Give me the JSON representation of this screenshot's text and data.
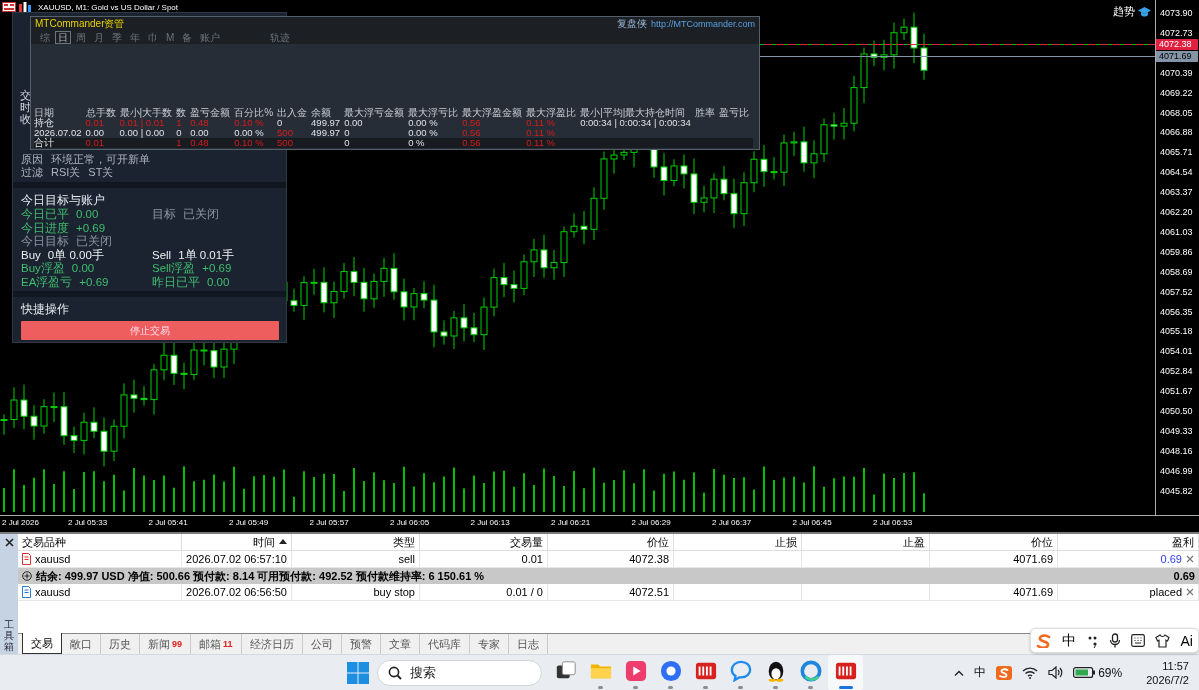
{
  "chart": {
    "title": "XAUUSD, M1:  Gold vs US Dollar / Spot",
    "indicator_label": "趋势",
    "price_ticks": [
      "4073.90",
      "4072.73",
      "4070.39",
      "4069.22",
      "4068.05",
      "4066.88",
      "4065.71",
      "4064.54",
      "4063.37",
      "4062.20",
      "4061.03",
      "4059.86",
      "4058.69",
      "4057.52",
      "4056.35",
      "4055.18",
      "4054.01",
      "4052.84",
      "4051.67",
      "4050.50",
      "4049.33",
      "4048.16",
      "4046.99",
      "4045.82"
    ],
    "bid_tag": "4072.38",
    "ask_tag": "4071.69",
    "time_ticks": [
      "2 Jul 2026",
      "2 Jul 05:33",
      "2 Jul 05:41",
      "2 Jul 05:49",
      "2 Jul 05:57",
      "2 Jul 06:05",
      "2 Jul 06:13",
      "2 Jul 06:21",
      "2 Jul 06:29",
      "2 Jul 06:37",
      "2 Jul 06:45",
      "2 Jul 06:53"
    ]
  },
  "status_panel": {
    "side_labels": [
      "交",
      "时",
      "收"
    ],
    "reason_label": "原因",
    "reason": "环境正常，可开新单",
    "filter_label": "过滤",
    "filters": [
      "RSI关",
      "ST关"
    ],
    "account_title": "今日目标与账户",
    "account_rows": [
      {
        "left": {
          "label": "今日已平",
          "value": "0.00",
          "kind": "gain"
        },
        "right": {
          "label": "目标",
          "value": "已关闭",
          "kind": "muted"
        }
      },
      {
        "left": {
          "label": "今日进度",
          "value": "+0.69",
          "kind": "gain"
        }
      },
      {
        "left": {
          "label": "今日目标",
          "value": "已关闭",
          "kind": "muted"
        }
      },
      {
        "left": {
          "label": "Buy",
          "value": "0单  0.00手",
          "kind": "plain"
        },
        "right": {
          "label": "Sell",
          "value": "1单  0.01手",
          "kind": "plain"
        }
      },
      {
        "left": {
          "label": "Buy浮盈",
          "value": "0.00",
          "kind": "gain"
        },
        "right": {
          "label": "Sell浮盈",
          "value": "+0.69",
          "kind": "gain"
        }
      },
      {
        "left": {
          "label": "EA浮盈亏",
          "value": "+0.69",
          "kind": "gain"
        },
        "right": {
          "label": "昨日已平",
          "value": "0.00",
          "kind": "gain"
        }
      }
    ],
    "actions_title": "快捷操作",
    "stop_button": "停止交易"
  },
  "commander": {
    "title": "MTCommander资管",
    "brand": "复盘侠",
    "link": "http://MTCommander.com",
    "tabs": [
      {
        "label": "综",
        "selected": false
      },
      {
        "label": "日",
        "selected": true
      },
      {
        "label": "周",
        "selected": false
      },
      {
        "label": "月",
        "selected": false
      },
      {
        "label": "季",
        "selected": false
      },
      {
        "label": "年",
        "selected": false
      },
      {
        "label": "巾",
        "selected": false
      },
      {
        "label": "M",
        "selected": false
      },
      {
        "label": "备",
        "selected": false
      },
      {
        "label": "账户",
        "selected": false
      }
    ],
    "extra_tabs": [
      {
        "label": "轨迹",
        "selected": false
      }
    ],
    "columns": [
      "日期",
      "总手数",
      "最小|大手数",
      "数",
      "盈亏金额",
      "百分比%",
      "出入金",
      "余额",
      "最大浮亏金额",
      "最大浮亏比",
      "最大浮盈金额",
      "最大浮盈比",
      "最小|平均|最大持仓时间",
      "胜率",
      "盈亏比"
    ],
    "rows": [
      {
        "kind": "position",
        "cells": [
          {
            "text": "持仓",
            "alert": false
          },
          {
            "text": "0.01",
            "alert": true
          },
          {
            "text": "0.01 | 0.01",
            "alert": true
          },
          {
            "text": "1",
            "alert": true
          },
          {
            "text": "0.48",
            "alert": true
          },
          {
            "text": "0.10 %",
            "alert": true
          },
          {
            "text": "0",
            "alert": false
          },
          {
            "text": "499.97",
            "alert": false
          },
          {
            "text": "0.00",
            "alert": false
          },
          {
            "text": "0.00 %",
            "alert": false
          },
          {
            "text": "0.56",
            "alert": true
          },
          {
            "text": "0.11 %",
            "alert": true
          },
          {
            "text": "0:00:34 | 0:00:34 | 0:00:34",
            "alert": false
          },
          null,
          null
        ]
      },
      {
        "kind": "day",
        "cells": [
          {
            "text": "2026.07.02",
            "alert": false
          },
          {
            "text": "0.00",
            "alert": false
          },
          {
            "text": "0.00 | 0.00",
            "alert": false
          },
          {
            "text": "0",
            "alert": false
          },
          {
            "text": "0.00",
            "alert": false
          },
          {
            "text": "0.00 %",
            "alert": false
          },
          {
            "text": "500",
            "alert": true
          },
          {
            "text": "499.97",
            "alert": false
          },
          {
            "text": "0",
            "alert": false
          },
          {
            "text": "0.00 %",
            "alert": false
          },
          {
            "text": "0.56",
            "alert": true
          },
          {
            "text": "0.11 %",
            "alert": true
          },
          null,
          null,
          null
        ]
      },
      {
        "kind": "total",
        "cells": [
          {
            "text": "合计",
            "alert": false
          },
          {
            "text": "0.01",
            "alert": true
          },
          null,
          {
            "text": "1",
            "alert": true
          },
          {
            "text": "0.48",
            "alert": true
          },
          {
            "text": "0.10 %",
            "alert": true
          },
          {
            "text": "500",
            "alert": true
          },
          null,
          {
            "text": "0",
            "alert": false
          },
          {
            "text": "0 %",
            "alert": false
          },
          {
            "text": "0.56",
            "alert": true
          },
          {
            "text": "0.11 %",
            "alert": true
          },
          null,
          null,
          null
        ]
      }
    ]
  },
  "terminal": {
    "side_title": "工具箱",
    "columns": [
      {
        "label": "交易品种",
        "sorted": false
      },
      {
        "label": "时间",
        "sorted": true
      },
      {
        "label": "类型",
        "sorted": false
      },
      {
        "label": "交易量",
        "sorted": false
      },
      {
        "label": "价位",
        "sorted": false
      },
      {
        "label": "止损",
        "sorted": false
      },
      {
        "label": "止盈",
        "sorted": false
      },
      {
        "label": "价位",
        "sorted": false
      },
      {
        "label": "盈利",
        "sorted": false
      }
    ],
    "rows": [
      {
        "kind": "position",
        "symbol": "xauusd",
        "cells": [
          "2026.07.02 06:57:10",
          "sell",
          "0.01",
          "4072.38",
          null,
          null,
          "4071.69",
          "0.69"
        ],
        "profit_highlight": true
      },
      {
        "kind": "summary",
        "text": "结余: 499.97 USD  净值: 500.66  预付款: 8.14  可用预付款: 492.52  预付款维持率: 6 150.61 %",
        "total": "0.69"
      },
      {
        "kind": "order",
        "symbol": "xauusd",
        "cells": [
          "2026.07.02 06:56:50",
          "buy stop",
          "0.01 / 0",
          "4072.51",
          null,
          null,
          "4071.69",
          "placed"
        ],
        "profit_highlight": false
      }
    ],
    "tabs": [
      {
        "label": "交易",
        "selected": true
      },
      {
        "label": "敞口",
        "selected": false
      },
      {
        "label": "历史",
        "selected": false
      },
      {
        "label": "新闻",
        "badge": "99",
        "selected": false
      },
      {
        "label": "邮箱",
        "badge": "11",
        "selected": false
      },
      {
        "label": "经济日历",
        "selected": false
      },
      {
        "label": "公司",
        "selected": false
      },
      {
        "label": "预警",
        "selected": false
      },
      {
        "label": "文章",
        "selected": false
      },
      {
        "label": "代码库",
        "selected": false
      },
      {
        "label": "专家",
        "selected": false
      },
      {
        "label": "日志",
        "selected": false
      }
    ]
  },
  "ime_bar": {
    "mode": "中",
    "ai": "Ai"
  },
  "taskbar": {
    "search_placeholder": "搜索",
    "apps": [
      {
        "kind": "taskview",
        "running": false,
        "active": false
      },
      {
        "kind": "folder",
        "running": true,
        "active": false
      },
      {
        "kind": "video",
        "running": true,
        "active": false
      },
      {
        "kind": "browser",
        "running": true,
        "active": false
      },
      {
        "kind": "stock",
        "running": true,
        "active": false
      },
      {
        "kind": "chat",
        "running": true,
        "active": false
      },
      {
        "kind": "penguin",
        "running": true,
        "active": false
      },
      {
        "kind": "edge",
        "running": true,
        "active": false
      },
      {
        "kind": "stock",
        "running": true,
        "active": true
      }
    ],
    "language": "中",
    "battery": "69%",
    "time": "11:57",
    "date": "2026/7/2"
  }
}
